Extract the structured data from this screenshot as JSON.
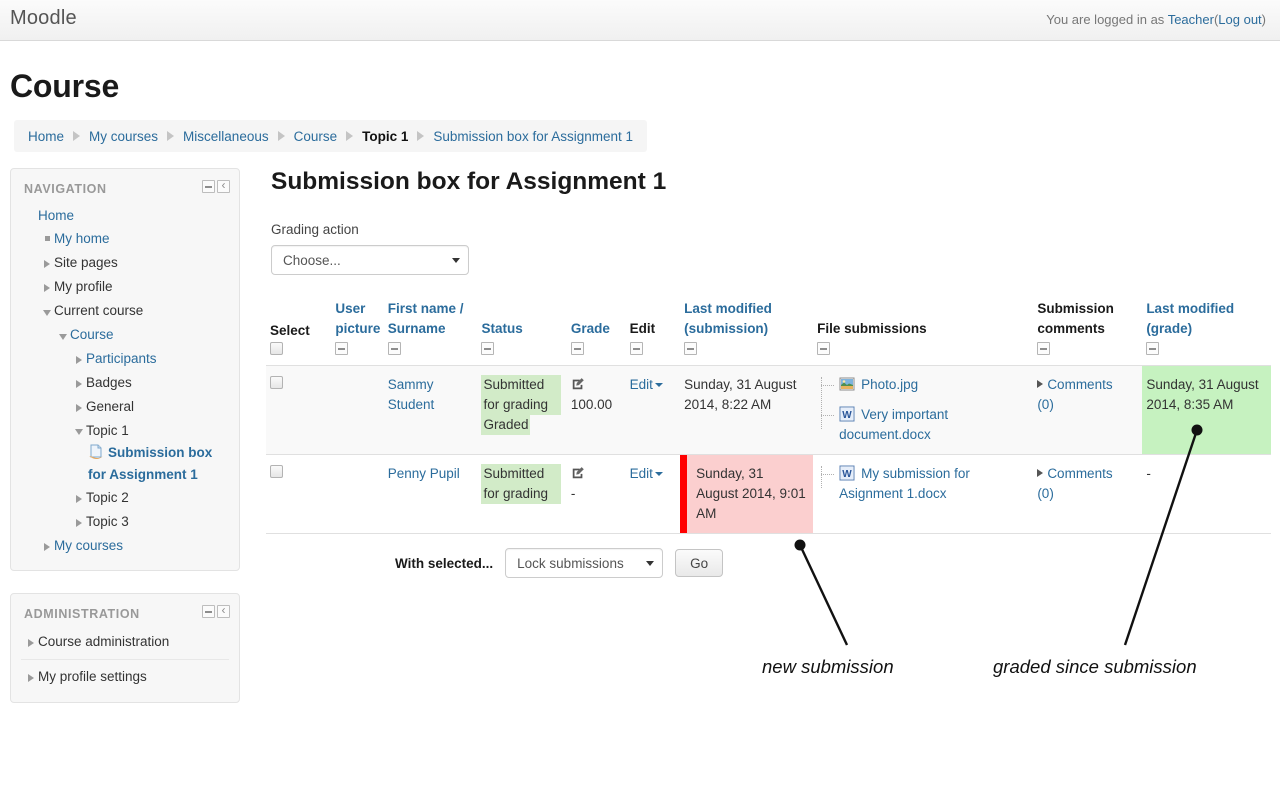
{
  "header": {
    "logo": "Moodle",
    "logged_in_prefix": "You are logged in as",
    "user_name": "Teacher",
    "logout_open": "(",
    "logout_label": "Log out",
    "logout_close": ")"
  },
  "page": {
    "title": "Course"
  },
  "breadcrumb": {
    "items": [
      {
        "label": "Home",
        "current": false
      },
      {
        "label": "My courses",
        "current": false
      },
      {
        "label": "Miscellaneous",
        "current": false
      },
      {
        "label": "Course",
        "current": false
      },
      {
        "label": "Topic 1",
        "current": true
      },
      {
        "label": "Submission box for Assignment 1",
        "current": false
      }
    ]
  },
  "navigation_block": {
    "title": "NAVIGATION",
    "items": [
      {
        "label": "Home",
        "marker": "none",
        "indent": 0,
        "link": true,
        "bold": false
      },
      {
        "label": "My home",
        "marker": "square",
        "indent": 1,
        "link": true,
        "bold": false
      },
      {
        "label": "Site pages",
        "marker": "right",
        "indent": 1,
        "link": false,
        "bold": false
      },
      {
        "label": "My profile",
        "marker": "right",
        "indent": 1,
        "link": false,
        "bold": false
      },
      {
        "label": "Current course",
        "marker": "down",
        "indent": 1,
        "link": false,
        "bold": false
      },
      {
        "label": "Course",
        "marker": "down",
        "indent": 2,
        "link": true,
        "bold": false
      },
      {
        "label": "Participants",
        "marker": "right",
        "indent": 3,
        "link": true,
        "bold": false
      },
      {
        "label": "Badges",
        "marker": "right",
        "indent": 3,
        "link": false,
        "bold": false
      },
      {
        "label": "General",
        "marker": "right",
        "indent": 3,
        "link": false,
        "bold": false
      },
      {
        "label": "Topic 1",
        "marker": "down",
        "indent": 3,
        "link": false,
        "bold": false
      },
      {
        "label": "Submission box for Assignment 1",
        "marker": "doc",
        "indent": 4,
        "link": true,
        "bold": true
      },
      {
        "label": "Topic 2",
        "marker": "right",
        "indent": 3,
        "link": false,
        "bold": false
      },
      {
        "label": "Topic 3",
        "marker": "right",
        "indent": 3,
        "link": false,
        "bold": false
      },
      {
        "label": "My courses",
        "marker": "right",
        "indent": 1,
        "link": true,
        "bold": false
      }
    ]
  },
  "administration_block": {
    "title": "ADMINISTRATION",
    "items": [
      {
        "label": "Course administration"
      },
      {
        "label": "My profile settings"
      }
    ]
  },
  "main": {
    "title": "Submission box for Assignment 1",
    "grading_action_label": "Grading action",
    "grading_action_value": "Choose...",
    "with_selected_label": "With selected...",
    "bulk_action_value": "Lock submissions",
    "go_label": "Go"
  },
  "table": {
    "columns": [
      {
        "key": "select",
        "label": "Select",
        "link": false,
        "toggle": false,
        "header_checkbox": true
      },
      {
        "key": "picture",
        "label": "User picture",
        "link": true,
        "toggle": true
      },
      {
        "key": "name",
        "label": "First name / Surname",
        "link": true,
        "toggle": true
      },
      {
        "key": "status",
        "label": "Status",
        "link": true,
        "toggle": true
      },
      {
        "key": "grade",
        "label": "Grade",
        "link": true,
        "toggle": true
      },
      {
        "key": "edit",
        "label": "Edit",
        "link": false,
        "toggle": true
      },
      {
        "key": "lm_submission",
        "label": "Last modified (submission)",
        "link": true,
        "toggle": true
      },
      {
        "key": "files",
        "label": "File submissions",
        "link": false,
        "toggle": true
      },
      {
        "key": "comments",
        "label": "Submission comments",
        "link": false,
        "toggle": true
      },
      {
        "key": "lm_grade",
        "label": "Last modified (grade)",
        "link": true,
        "toggle": true
      }
    ],
    "rows": [
      {
        "name": "Sammy Student",
        "status_lines": [
          "Submitted for grading",
          "Graded"
        ],
        "grade": "100.00",
        "edit_label": "Edit",
        "last_modified_submission": "Sunday, 31 August 2014, 8:22 AM",
        "submission_flagged": false,
        "files": [
          {
            "name": "Photo.jpg",
            "icon": "image-file-icon"
          },
          {
            "name": "Very important document.docx",
            "icon": "word-file-icon"
          }
        ],
        "comments_label": "Comments",
        "comments_count": "(0)",
        "last_modified_grade": "Sunday, 31 August 2014, 8:35 AM",
        "grade_highlighted": true
      },
      {
        "name": "Penny Pupil",
        "status_lines": [
          "Submitted for grading"
        ],
        "grade": "-",
        "edit_label": "Edit",
        "last_modified_submission": "Sunday, 31 August 2014, 9:01 AM",
        "submission_flagged": true,
        "files": [
          {
            "name": "My submission for Asignment 1.docx",
            "icon": "word-file-icon"
          }
        ],
        "comments_label": "Comments",
        "comments_count": "(0)",
        "last_modified_grade": "-",
        "grade_highlighted": false
      }
    ]
  },
  "annotations": [
    {
      "text": "new submission"
    },
    {
      "text": "graded since submission"
    }
  ],
  "colors": {
    "link": "#2b6c9c",
    "status_green": "#d2ebc8",
    "grade_green": "#c6f2c0",
    "submission_pink": "#fbcfcf",
    "flag_red": "#ff0000"
  }
}
